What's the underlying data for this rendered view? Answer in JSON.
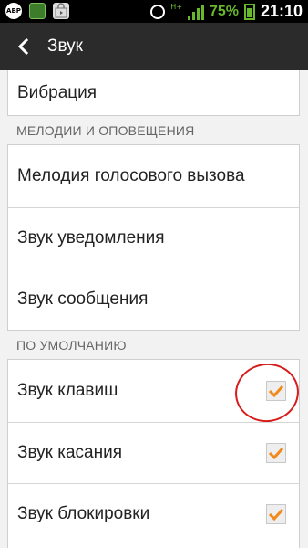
{
  "status_bar": {
    "abp_label": "ABP",
    "battery_percent": "75%",
    "time": "21:10",
    "network_type": "H+",
    "icons": [
      "abp-icon",
      "app-cube-icon",
      "shopping-bag-icon",
      "alarm-icon",
      "signal-icon",
      "battery-icon"
    ]
  },
  "action_bar": {
    "title": "Звук",
    "back_icon": "chevron-left-icon"
  },
  "top_list": {
    "items": [
      {
        "label": "Вибрация"
      }
    ]
  },
  "sections": {
    "melodies": {
      "header": "МЕЛОДИИ И ОПОВЕЩЕНИЯ",
      "items": [
        {
          "label": "Мелодия голосового вызова"
        },
        {
          "label": "Звук уведомления"
        },
        {
          "label": "Звук сообщения"
        }
      ]
    },
    "defaults": {
      "header": "ПО УМОЛЧАНИЮ",
      "items": [
        {
          "label": "Звук клавиш",
          "checked": true
        },
        {
          "label": "Звук касания",
          "checked": true
        },
        {
          "label": "Звук блокировки",
          "checked": true
        }
      ]
    }
  },
  "colors": {
    "check_orange": "#f28a1b",
    "annotation_red": "#d81b1b",
    "status_green": "#67b82a",
    "actionbar_bg": "#2b2b2b"
  }
}
